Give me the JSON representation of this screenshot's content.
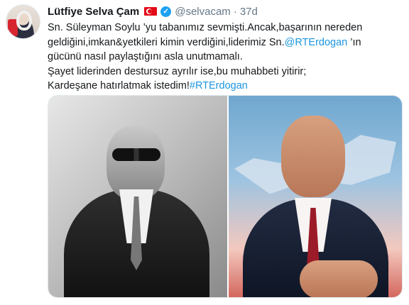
{
  "tweet": {
    "display_name": "Lütfiye Selva Çam",
    "handle": "@selvacam",
    "separator": "·",
    "timestamp": "37d",
    "lines": [
      {
        "text": "Sn. Süleyman Soylu ’yu tabanımız sevmişti.Ancak,başarının nereden"
      },
      {
        "before": "geldiğini,imkan&yetkileri kimin verdiğini,liderimiz Sn.",
        "mention": "@RTErdogan",
        "after": " ’ın"
      },
      {
        "text": "gücünü nasıl paylaştığını asla unutmamalı."
      },
      {
        "text": "Şayet liderinden destursuz ayrılır ise,bu muhabbeti yitirir;"
      },
      {
        "before": "Kardeşane hatırlatmak istedim!",
        "hashtag": "#RTErdogan"
      }
    ]
  },
  "icons": {
    "flag": "turkey-flag-icon",
    "verified": "verified-badge-icon",
    "verified_glyph": "✓"
  },
  "colors": {
    "link": "#1b95e0",
    "secondary_text": "#657786",
    "verified": "#1da1f2",
    "flag": "#e30a17"
  }
}
